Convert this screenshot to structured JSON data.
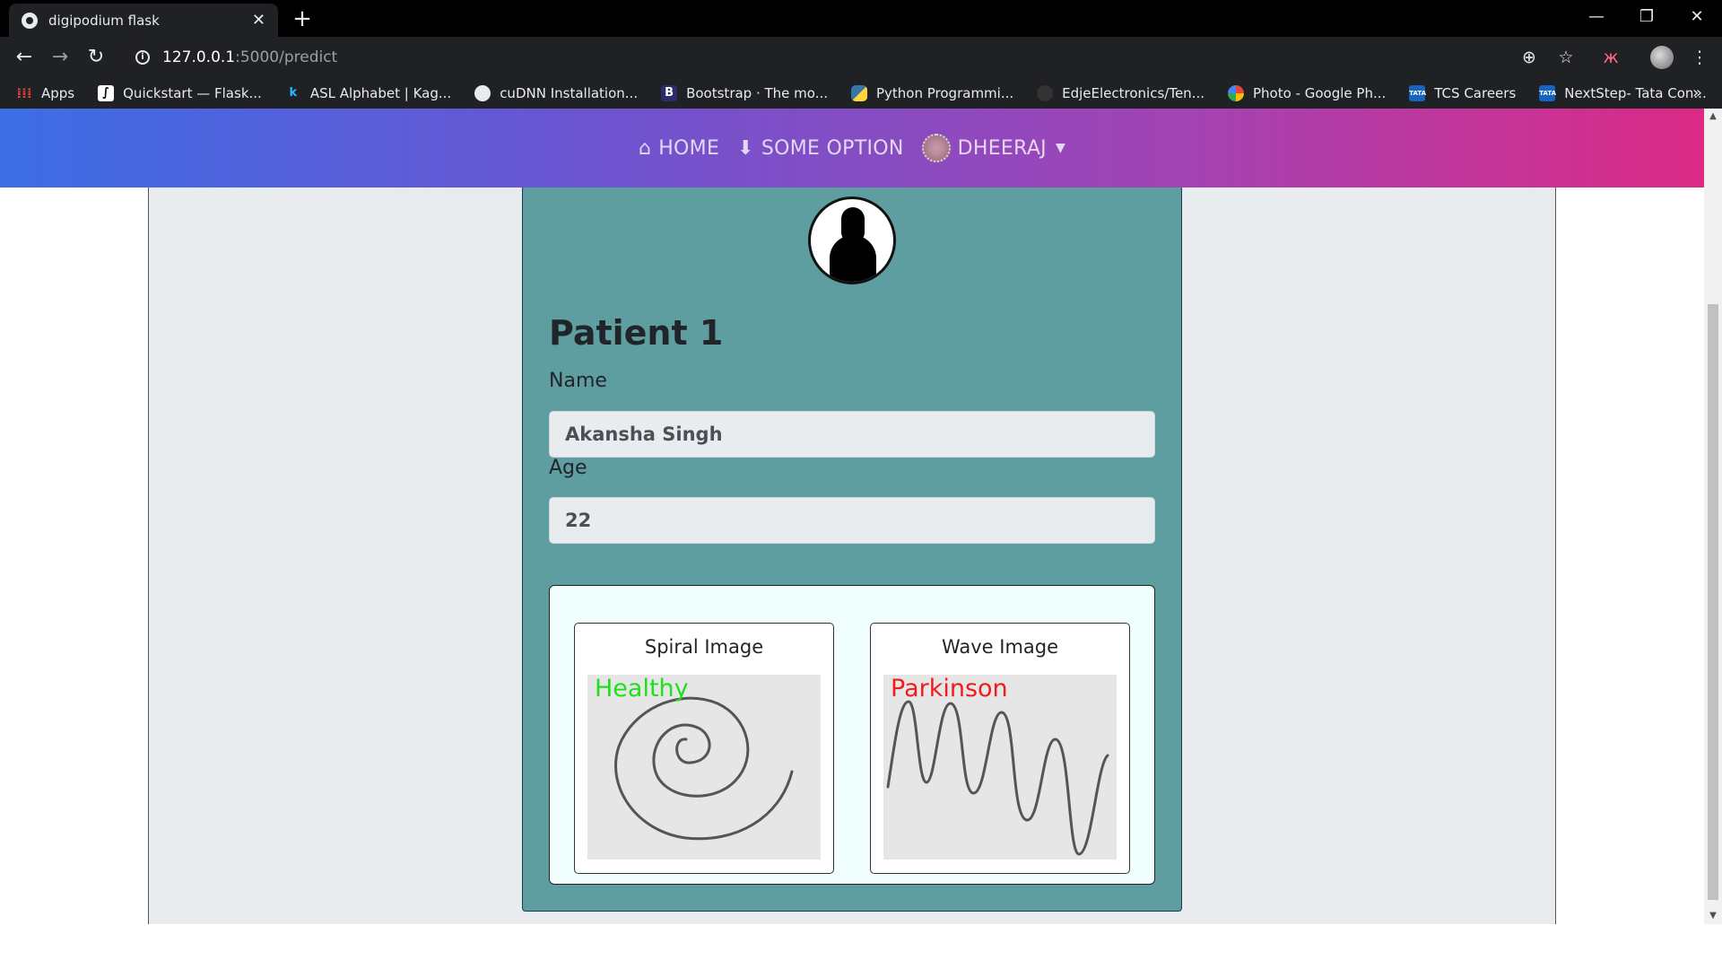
{
  "browser": {
    "tab_title": "digipodium flask",
    "url_host": "127.0.0.1",
    "url_path": ":5000/predict",
    "bookmarks": [
      {
        "label": "Apps",
        "icon": "apps-grid-icon"
      },
      {
        "label": "Quickstart — Flask...",
        "icon": "flask-icon"
      },
      {
        "label": "ASL Alphabet | Kag...",
        "icon": "kaggle-icon"
      },
      {
        "label": "cuDNN Installation...",
        "icon": "globe-icon"
      },
      {
        "label": "Bootstrap · The mo...",
        "icon": "bootstrap-icon"
      },
      {
        "label": "Python Programmi...",
        "icon": "python-icon"
      },
      {
        "label": "EdjeElectronics/Ten...",
        "icon": "github-icon"
      },
      {
        "label": "Photo - Google Ph...",
        "icon": "google-photos-icon"
      },
      {
        "label": "TCS Careers",
        "icon": "tata-icon"
      },
      {
        "label": "NextStep- Tata Con...",
        "icon": "tata-icon"
      }
    ],
    "more_bookmarks": "»"
  },
  "navbar": {
    "home_label": "HOME",
    "option_label": "SOME OPTION",
    "user_label": "DHEERAJ"
  },
  "patient": {
    "title": "Patient 1",
    "name_label": "Name",
    "name_value": "Akansha Singh",
    "age_label": "Age",
    "age_value": "22"
  },
  "results": {
    "spiral": {
      "title": "Spiral Image",
      "prediction": "Healthy",
      "prediction_color": "#1ee01e"
    },
    "wave": {
      "title": "Wave Image",
      "prediction": "Parkinson",
      "prediction_color": "#ee1c1c"
    }
  }
}
